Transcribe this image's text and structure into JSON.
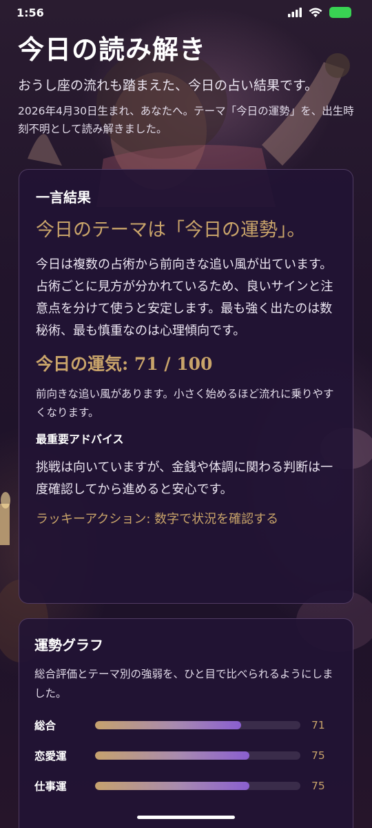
{
  "status_bar": {
    "time": "1:56"
  },
  "header": {
    "title": "今日の読み解き",
    "subtitle": "おうし座の流れも踏まえた、今日の占い結果です。",
    "description": "2026年4月30日生まれ、あなたへ。テーマ「今日の運勢」を、出生時刻不明として読み解きました。"
  },
  "result_card": {
    "heading": "一言結果",
    "theme_headline": "今日のテーマは「今日の運勢」。",
    "summary": "今日は複数の占術から前向きな追い風が出ています。占術ごとに見方が分かれているため、良いサインと注意点を分けて使うと安定します。最も強く出たのは数秘術、最も慎重なのは心理傾向です。",
    "score_line": "今日の運気: 71 / 100",
    "score_comment": "前向きな追い風があります。小さく始めるほど流れに乗りやすくなります。",
    "advice_heading": "最重要アドバイス",
    "advice": "挑戦は向いていますが、金銭や体調に関わる判断は一度確認してから進めると安心です。",
    "lucky_action": "ラッキーアクション: 数字で状況を確認する"
  },
  "graph_card": {
    "heading": "運勢グラフ",
    "description": "総合評価とテーマ別の強弱を、ひと目で比べられるようにしました。",
    "max": 100,
    "items": [
      {
        "label": "総合",
        "value": 71,
        "display": "71"
      },
      {
        "label": "恋愛運",
        "value": 75,
        "display": "75"
      },
      {
        "label": "仕事運",
        "value": 75,
        "display": "75"
      }
    ]
  },
  "colors": {
    "accent_gold": "#c9a46a",
    "bar_start": "#c6a26e",
    "bar_end": "#8a5fd0",
    "battery": "#39d353"
  },
  "icons": [
    "cellular-signal-icon",
    "wifi-icon",
    "battery-icon"
  ]
}
